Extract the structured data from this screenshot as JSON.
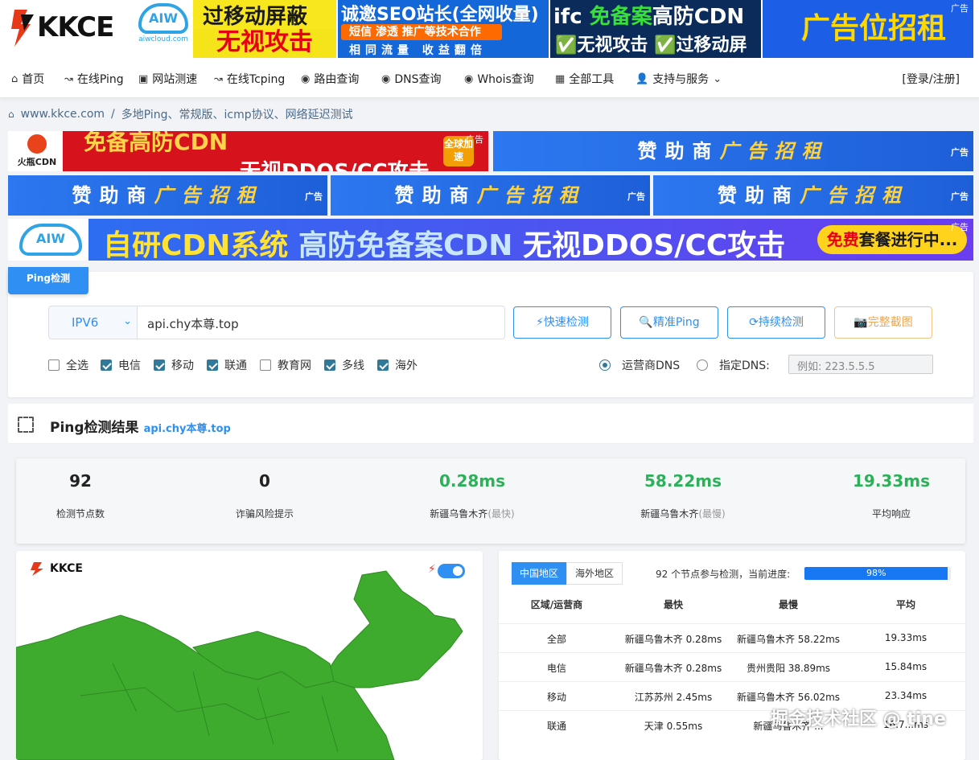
{
  "brand": {
    "logo_text": "KKCE",
    "aiw_logo": "AIW",
    "aiw_site": "aiwcloud.com"
  },
  "top_ads": [
    {
      "line1": "过移动屏蔽",
      "line2": "无视攻击"
    },
    {
      "line1": "诚邀SEO站长(全网收量)",
      "line2": "短信 渗透 推广等技术合作",
      "line3": "相同流量 收益翻倍"
    },
    {
      "line1_a": "ifc",
      "line1_b": "免备案",
      "line1_c": "高防CDN",
      "line2": "✅无视攻击 ✅过移动屏蔽"
    },
    {
      "line1": "广告位招租",
      "tag": "广告"
    }
  ],
  "nav": {
    "items": [
      {
        "icon": "home-icon",
        "glyph": "⌂",
        "label": "首页"
      },
      {
        "icon": "ping-icon",
        "glyph": "↝",
        "label": "在线Ping"
      },
      {
        "icon": "monitor-icon",
        "glyph": "▣",
        "label": "网站测速"
      },
      {
        "icon": "tcping-icon",
        "glyph": "↝",
        "label": "在线Tcping"
      },
      {
        "icon": "route-icon",
        "glyph": "◉",
        "label": "路由查询"
      },
      {
        "icon": "dns-icon",
        "glyph": "◉",
        "label": "DNS查询"
      },
      {
        "icon": "whois-icon",
        "glyph": "◉",
        "label": "Whois查询"
      },
      {
        "icon": "grid-icon",
        "glyph": "▦",
        "label": "全部工具"
      },
      {
        "icon": "user-icon",
        "glyph": "👤",
        "label": "支持与服务"
      }
    ],
    "login": "[登录/注册]"
  },
  "breadcrumb": {
    "site": "www.kkce.com",
    "sep": "/",
    "page": "多地Ping、常规版、icmp协议、网络延迟测试"
  },
  "banners": {
    "fire": {
      "logo": "火瓶CDN",
      "line1": "免备高防CDN",
      "line2": "无视DDOS/CC攻击",
      "badge": "全球加速",
      "tag": "广告"
    },
    "sponsor_a": "赞助商",
    "sponsor_b": "广告招租",
    "tag": "广告",
    "aiw": {
      "p1": "自研CDN系统",
      "p2": "高防免备案CDN",
      "p3": "无视DDOS/CC攻击",
      "pill_a": "免费",
      "pill_b": "套餐进行中...",
      "logo": "AIW",
      "tag": "广告"
    }
  },
  "form": {
    "tab": "Ping检测",
    "ip_version": "IPV6",
    "host": "api.chy本尊.top",
    "buttons": {
      "fast": "⚡快速检测",
      "precise": "🔍精准Ping",
      "continuous": "⟳持续检测",
      "screenshot": "📷完整截图"
    },
    "isps": [
      {
        "label": "全选",
        "checked": false
      },
      {
        "label": "电信",
        "checked": true
      },
      {
        "label": "移动",
        "checked": true
      },
      {
        "label": "联通",
        "checked": true
      },
      {
        "label": "教育网",
        "checked": false
      },
      {
        "label": "多线",
        "checked": true
      },
      {
        "label": "海外",
        "checked": true
      }
    ],
    "dns": {
      "isp_label": "运营商DNS",
      "custom_label": "指定DNS:",
      "placeholder": "例如: 223.5.5.5"
    }
  },
  "results": {
    "title": "Ping检测结果",
    "domain": "api.chy本尊.top",
    "stats": [
      {
        "value": "92",
        "label": "检测节点数",
        "note": ""
      },
      {
        "value": "0",
        "label": "诈骗风险提示",
        "note": ""
      },
      {
        "value": "0.28ms",
        "label": "新疆乌鲁木齐",
        "note": "(最快)"
      },
      {
        "value": "58.22ms",
        "label": "新疆乌鲁木齐",
        "note": "(最慢)"
      },
      {
        "value": "19.33ms",
        "label": "平均响应",
        "note": ""
      }
    ]
  },
  "map": {
    "logo": "KKCE"
  },
  "table": {
    "tabs": [
      "中国地区",
      "海外地区"
    ],
    "node_count": "92",
    "progress_text": "个节点参与检测，当前进度:",
    "progress": "98%",
    "progress_fraction": 0.98,
    "headers": [
      "区域/运营商",
      "最快",
      "最慢",
      "平均"
    ],
    "rows": [
      [
        "全部",
        "新疆乌鲁木齐 0.28ms",
        "新疆乌鲁木齐 58.22ms",
        "19.33ms"
      ],
      [
        "电信",
        "新疆乌鲁木齐 0.28ms",
        "贵州贵阳 38.89ms",
        "15.84ms"
      ],
      [
        "移动",
        "江苏苏州 2.45ms",
        "新疆乌鲁木齐 56.02ms",
        "23.34ms"
      ],
      [
        "联通",
        "天津 0.55ms",
        "新疆乌鲁木齐 ...",
        "16.7...ms"
      ]
    ]
  },
  "watermark": "掘金技术社区 @ tine",
  "colors": {
    "accent": "#2f8ff2",
    "good": "#2eb05a",
    "map_fill": "#3fab2e"
  }
}
